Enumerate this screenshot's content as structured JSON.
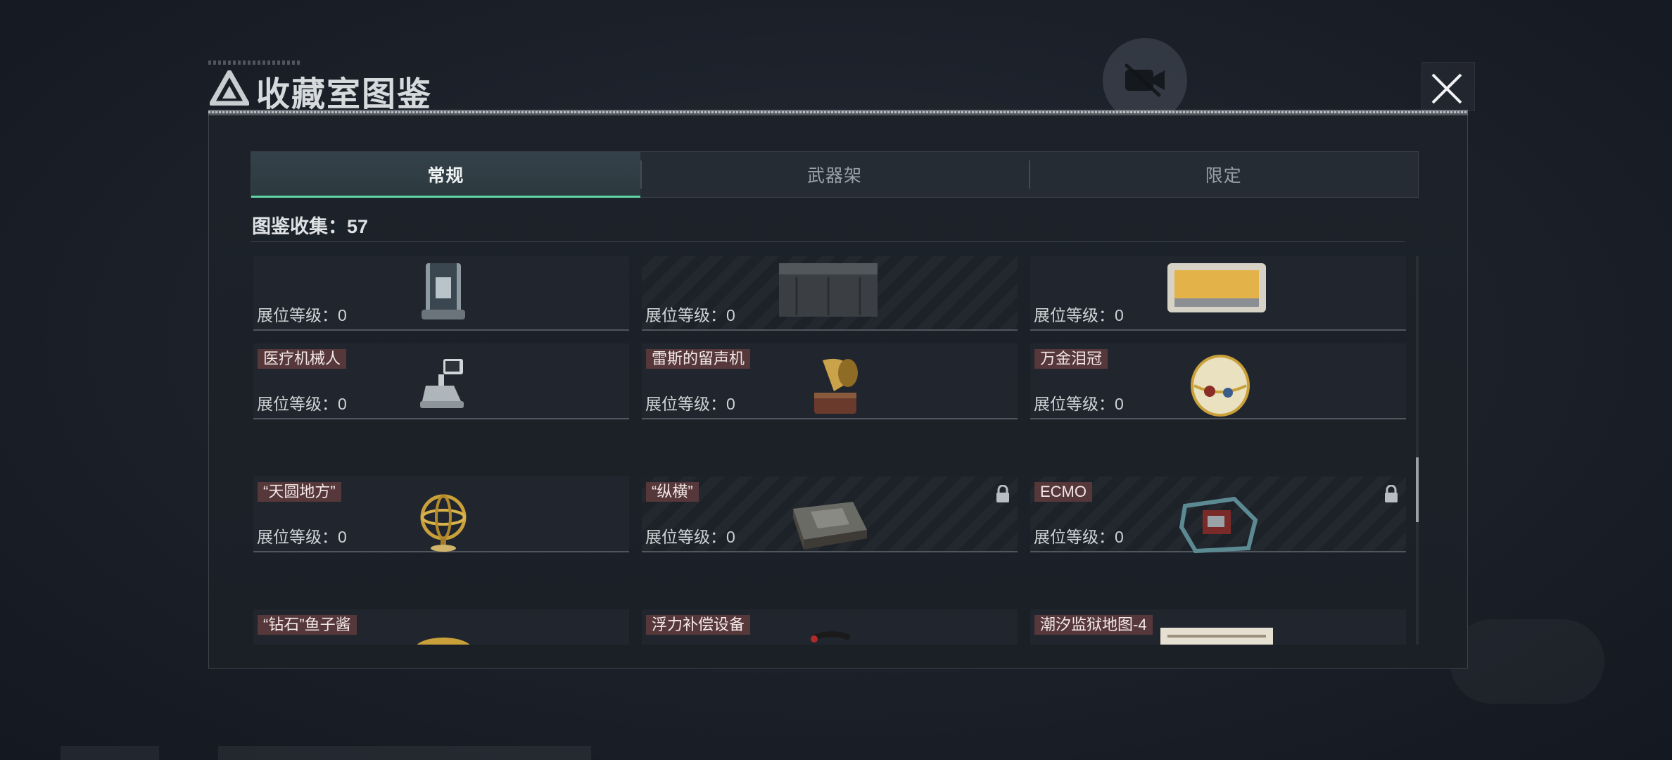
{
  "title": "收藏室图鉴",
  "tabs": [
    {
      "label": "常规",
      "active": true
    },
    {
      "label": "武器架",
      "active": false
    },
    {
      "label": "限定",
      "active": false
    }
  ],
  "collection_label": "图鉴收集：57",
  "level_label": "展位等级：0",
  "cards": [
    {
      "name": "",
      "level": "展位等级：0",
      "locked": false,
      "icon": "cryo-tube-icon"
    },
    {
      "name": "",
      "level": "展位等级：0",
      "locked": true,
      "icon": "server-case-icon"
    },
    {
      "name": "",
      "level": "展位等级：0",
      "locked": false,
      "icon": "battery-pack-icon"
    },
    {
      "name": "医疗机械人",
      "level": "展位等级：0",
      "locked": false,
      "icon": "medical-robot-icon"
    },
    {
      "name": "雷斯的留声机",
      "level": "展位等级：0",
      "locked": false,
      "icon": "gramophone-icon"
    },
    {
      "name": "万金泪冠",
      "level": "展位等级：0",
      "locked": false,
      "icon": "jeweled-egg-icon"
    },
    {
      "name": "“天圆地方”",
      "level": "展位等级：0",
      "locked": false,
      "icon": "armillary-sphere-icon"
    },
    {
      "name": "“纵横”",
      "level": "展位等级：0",
      "locked": true,
      "icon": "chess-board-icon"
    },
    {
      "name": "ECMO",
      "level": "展位等级：0",
      "locked": true,
      "icon": "ecmo-machine-icon"
    },
    {
      "name": "“钻石”鱼子酱",
      "level": "",
      "locked": false,
      "icon": "caviar-tin-icon"
    },
    {
      "name": "浮力补偿设备",
      "level": "",
      "locked": false,
      "icon": "buoyancy-device-icon"
    },
    {
      "name": "潮汐监狱地图-4",
      "level": "",
      "locked": false,
      "icon": "prison-map-icon"
    }
  ],
  "colors": {
    "accent": "#5fd7a5",
    "name_tag": "#56383a",
    "panel": "#1d222a"
  }
}
